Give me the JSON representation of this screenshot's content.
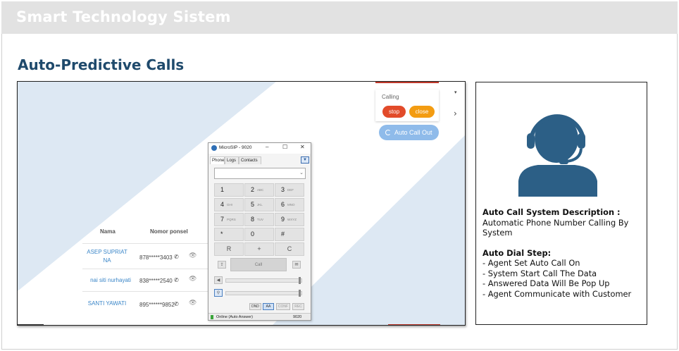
{
  "header": {
    "brand": "Smart Technology Sistem"
  },
  "section": {
    "title": "Auto-Predictive Calls"
  },
  "screenshot": {
    "calling_popup": {
      "label": "Calling",
      "stop_label": "stop",
      "close_label": "close"
    },
    "auto_call_button": "Auto Call Out",
    "table": {
      "headers": [
        "Nama",
        "Nomor ponsel"
      ],
      "rows": [
        {
          "name": "ASEP SUPRIAT NA",
          "phone": "878*****3403"
        },
        {
          "name": "nai siti nurhayati",
          "phone": "838*****2540"
        },
        {
          "name": "SANTI YAWATI",
          "phone": "895******9852"
        }
      ]
    },
    "microsip": {
      "title": "MicroSIP - 9020",
      "tabs": [
        "Phone",
        "Logs",
        "Contacts"
      ],
      "keys": [
        {
          "digit": "1",
          "letters": ""
        },
        {
          "digit": "2",
          "letters": "ABC"
        },
        {
          "digit": "3",
          "letters": "DEF"
        },
        {
          "digit": "4",
          "letters": "GHI"
        },
        {
          "digit": "5",
          "letters": "JKL"
        },
        {
          "digit": "6",
          "letters": "MNO"
        },
        {
          "digit": "7",
          "letters": "PQRS"
        },
        {
          "digit": "8",
          "letters": "TUV"
        },
        {
          "digit": "9",
          "letters": "WXYZ"
        },
        {
          "digit": "*",
          "letters": ""
        },
        {
          "digit": "0",
          "letters": ""
        },
        {
          "digit": "#",
          "letters": ""
        },
        {
          "digit": "R",
          "letters": ""
        },
        {
          "digit": "+",
          "letters": ""
        },
        {
          "digit": "C",
          "letters": ""
        }
      ],
      "call_label": "Call",
      "buttons": [
        "DND",
        "AA",
        "CONF",
        "REC"
      ],
      "status": "Online (Auto Answer)",
      "extension": "9020"
    }
  },
  "description": {
    "heading": "Auto Call System Description :",
    "body": "Automatic Phone Number Calling By System",
    "step_heading": "Auto Dial  Step:",
    "steps": [
      "- Agent Set Auto Call On",
      "- System Start Call The Data",
      "- Answered Data Will Be Pop Up",
      "- Agent Communicate with Customer"
    ]
  },
  "colors": {
    "title": "#1f4a6c",
    "header_bg": "#e2e2e2",
    "accent_blue": "#2c5f86",
    "stop": "#e24b2a",
    "close": "#f39c12",
    "auto_call": "#8fbbea"
  }
}
